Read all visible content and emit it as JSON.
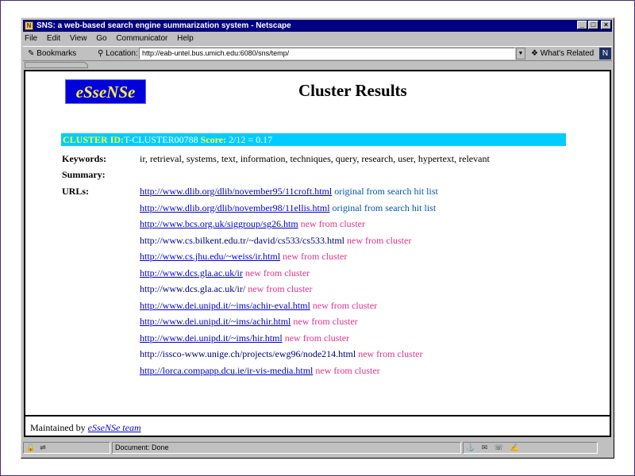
{
  "window": {
    "title": "SNS: a web-based search engine summarization system - Netscape",
    "app_icon": "netscape-icon",
    "controls": {
      "minimize": "_",
      "maximize": "□",
      "close": "×"
    }
  },
  "menu": [
    "File",
    "Edit",
    "View",
    "Go",
    "Communicator",
    "Help"
  ],
  "toolbar": {
    "bookmarks_label": "Bookmarks",
    "location_label": "Location:",
    "url": "http://eab-untel.bus.umich.edu:6080/sns/temp/",
    "whats_related_label": "What's Related"
  },
  "page": {
    "logo_text": "eSseNSe",
    "title": "Cluster Results",
    "cluster": {
      "id_label": "CLUSTER ID:",
      "id_value": "T-CLUSTER00788",
      "score_label": "Score:",
      "score_value": "2/12 = 0.17"
    },
    "keywords_label": "Keywords:",
    "keywords": "ir, retrieval, systems, text, information, techniques, query, research, user, hypertext, relevant",
    "summary_label": "Summary:",
    "urls_label": "URLs:",
    "urls": [
      {
        "url": "http://www.dlib.org/dlib/november95/11croft.html",
        "source": "original from search hit list"
      },
      {
        "url": "http://www.dlib.org/dlib/november98/11ellis.html",
        "source": "original from search hit list"
      },
      {
        "url": "http://www.bcs.org.uk/siggroup/sg26.htm",
        "source": "new from cluster"
      },
      {
        "url": "http://www.cs.bilkent.edu.tr/~david/cs533/cs533.html",
        "source": "new from cluster"
      },
      {
        "url": "http://www.cs.jhu.edu/~weiss/ir.html",
        "source": "new from cluster"
      },
      {
        "url": "http://www.dcs.gla.ac.uk/ir",
        "source": "new from cluster"
      },
      {
        "url": "http://www.dcs.gla.ac.uk/ir/",
        "source": "new from cluster"
      },
      {
        "url": "http://www.dei.unipd.it/~ims/achir-eval.html",
        "source": "new from cluster"
      },
      {
        "url": "http://www.dei.unipd.it/~ims/achir.html",
        "source": "new from cluster"
      },
      {
        "url": "http://www.dei.unipd.it/~ims/hir.html",
        "source": "new from cluster"
      },
      {
        "url": "http://issco-www.unige.ch/projects/ewg96/node214.html",
        "source": "new from cluster"
      },
      {
        "url": "http://lorca.compapp.dcu.ie/ir-vis-media.html",
        "source": "new from cluster"
      }
    ],
    "footer_text": "Maintained by",
    "footer_link": "eSseNSe team"
  },
  "status": {
    "text": "Document: Done",
    "icons": [
      "security-lock-icon",
      "online-icon",
      "navigator-icon",
      "mail-icon",
      "discussion-icon",
      "composer-icon"
    ]
  }
}
